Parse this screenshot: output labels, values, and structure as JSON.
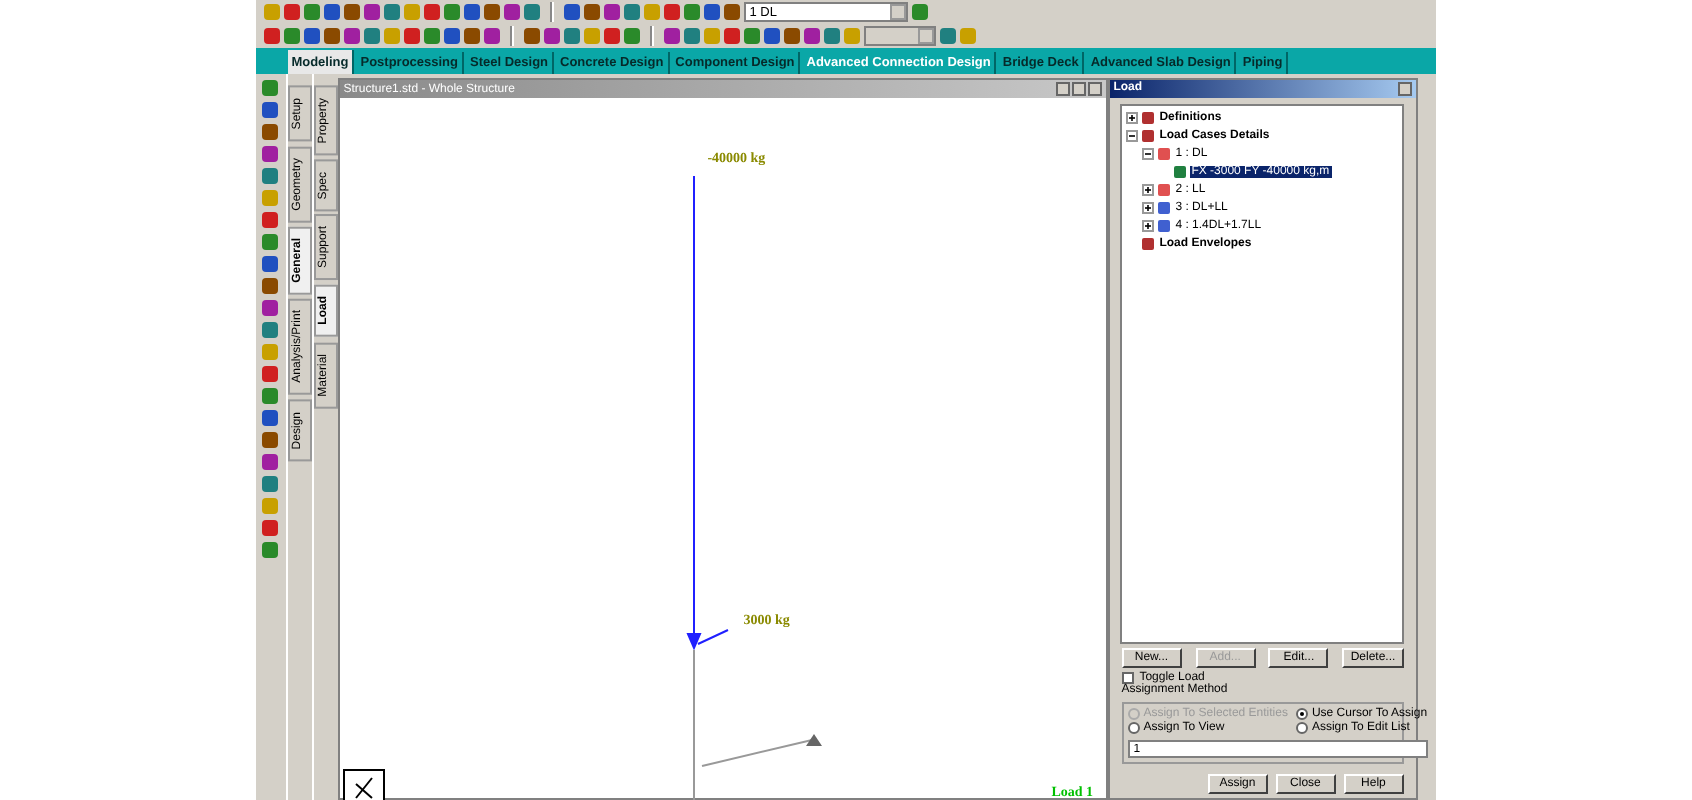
{
  "toolbar": {
    "load_case_select": "1 DL"
  },
  "tabs": [
    {
      "label": "Modeling",
      "selected": true,
      "highlighted": false
    },
    {
      "label": "Postprocessing",
      "selected": false,
      "highlighted": false
    },
    {
      "label": "Steel Design",
      "selected": false,
      "highlighted": false
    },
    {
      "label": "Concrete Design",
      "selected": false,
      "highlighted": false
    },
    {
      "label": "Component Design",
      "selected": false,
      "highlighted": false
    },
    {
      "label": "Advanced Connection Design",
      "selected": false,
      "highlighted": true
    },
    {
      "label": "Bridge Deck",
      "selected": false,
      "highlighted": false
    },
    {
      "label": "Advanced Slab Design",
      "selected": false,
      "highlighted": false
    },
    {
      "label": "Piping",
      "selected": false,
      "highlighted": false
    }
  ],
  "page_tabs": [
    {
      "label": "Setup",
      "selected": false
    },
    {
      "label": "Geometry",
      "selected": false
    },
    {
      "label": "General",
      "selected": true
    },
    {
      "label": "Analysis/Print",
      "selected": false
    },
    {
      "label": "Design",
      "selected": false
    }
  ],
  "sub_tabs": [
    {
      "label": "Property",
      "selected": false
    },
    {
      "label": "Spec",
      "selected": false
    },
    {
      "label": "Support",
      "selected": false
    },
    {
      "label": "Load",
      "selected": true
    },
    {
      "label": "Material",
      "selected": false
    }
  ],
  "viewport": {
    "title": "Structure1.std - Whole Structure",
    "labels": [
      {
        "text": "-40000 kg",
        "kind": "top"
      },
      {
        "text": "3000 kg",
        "kind": "side"
      }
    ],
    "load_label": "Load 1"
  },
  "load_panel": {
    "title": "Load",
    "tree": [
      {
        "label": "Definitions",
        "kind": "folder",
        "expanded": false,
        "selected": false
      },
      {
        "label": "Load Cases Details",
        "kind": "folder",
        "expanded": true,
        "selected": false,
        "children": [
          {
            "label": "1 : DL",
            "kind": "case",
            "expanded": true,
            "selected": false,
            "children": [
              {
                "label": "FX -3000 FY -40000 kg,m",
                "kind": "load",
                "selected": true
              }
            ]
          },
          {
            "label": "2 : LL",
            "kind": "case",
            "expanded": false,
            "selected": false
          },
          {
            "label": "3 : DL+LL",
            "kind": "combination",
            "expanded": false,
            "selected": false
          },
          {
            "label": "4 : 1.4DL+1.7LL",
            "kind": "combination",
            "expanded": false,
            "selected": false
          }
        ]
      },
      {
        "label": "Load Envelopes",
        "kind": "folder",
        "selected": false
      }
    ],
    "buttons": [
      {
        "label": "New...",
        "disabled": false
      },
      {
        "label": "Add...",
        "disabled": true
      },
      {
        "label": "Edit...",
        "disabled": false
      },
      {
        "label": "Delete...",
        "disabled": false
      }
    ],
    "toggle_load": {
      "label": "Toggle Load",
      "checked": false
    },
    "assignment": {
      "title": "Assignment Method",
      "options": [
        {
          "label": "Assign To Selected Entities",
          "selected": false,
          "disabled": true
        },
        {
          "label": "Use Cursor To Assign",
          "selected": true,
          "disabled": false
        },
        {
          "label": "Assign To View",
          "selected": false,
          "disabled": false
        },
        {
          "label": "Assign To Edit List",
          "selected": false,
          "disabled": false
        }
      ],
      "edit_list": "1"
    },
    "bottom_buttons": [
      "Assign",
      "Close",
      "Help"
    ]
  }
}
